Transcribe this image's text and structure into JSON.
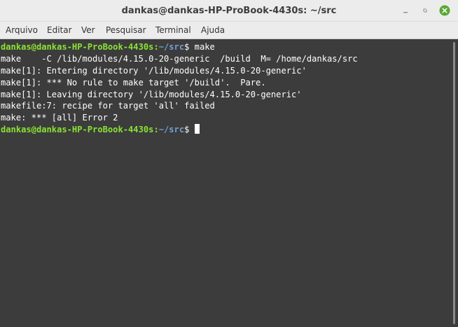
{
  "window": {
    "title": "dankas@dankas-HP-ProBook-4430s: ~/src",
    "controls": {
      "minimize_icon": "minimize-icon",
      "maximize_icon": "maximize-icon",
      "close_icon": "close-icon"
    }
  },
  "menubar": {
    "items": [
      {
        "label": "Arquivo"
      },
      {
        "label": "Editar"
      },
      {
        "label": "Ver"
      },
      {
        "label": "Pesquisar"
      },
      {
        "label": "Terminal"
      },
      {
        "label": "Ajuda"
      }
    ]
  },
  "terminal": {
    "prompt_user_host": "dankas@dankas-HP-ProBook-4430s",
    "prompt_path": "~/src",
    "prompt_symbol": "$",
    "command": " make",
    "output": [
      "make    -C /lib/modules/4.15.0-20-generic  /build  M= /home/dankas/src",
      "make[1]: Entering directory '/lib/modules/4.15.0-20-generic'",
      "make[1]: *** No rule to make target '/build'.  Pare.",
      "make[1]: Leaving directory '/lib/modules/4.15.0-20-generic'",
      "makefile:7: recipe for target 'all' failed",
      "make: *** [all] Error 2"
    ],
    "second_prompt_user_host": "dankas@dankas-HP-ProBook-4430s",
    "second_prompt_path": "~/src",
    "second_prompt_symbol": "$ "
  },
  "colors": {
    "terminal_bg": "#3c3c3c",
    "prompt_user": "#8ae234",
    "prompt_path": "#729fcf",
    "close_button": "#5aa832"
  }
}
